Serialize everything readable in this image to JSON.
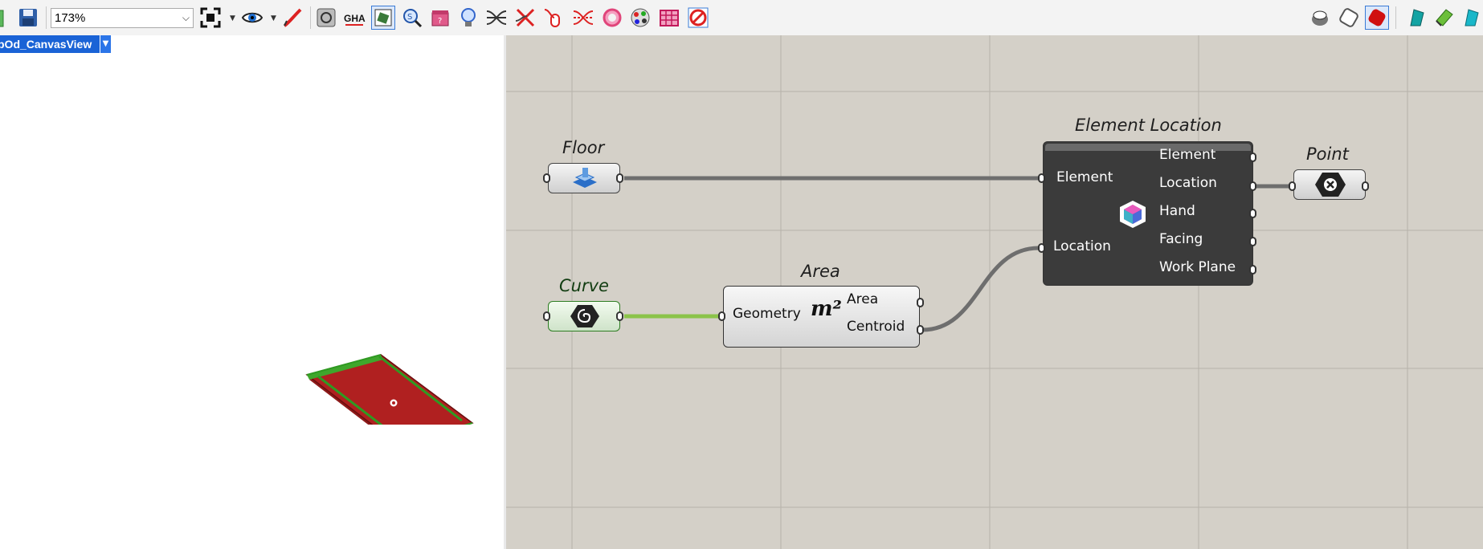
{
  "toolbar": {
    "zoom_value": "173%"
  },
  "viewport": {
    "label": "pOd_CanvasView"
  },
  "canvas": {
    "floor": {
      "caption": "Floor",
      "icon": "floor-element-icon"
    },
    "curve": {
      "caption": "Curve",
      "icon": "curve-param-icon"
    },
    "area": {
      "caption": "Area",
      "input": "Geometry",
      "outputs": [
        "Area",
        "Centroid"
      ],
      "icon": "m-squared-icon"
    },
    "element_location": {
      "caption": "Element Location",
      "inputs": [
        "Element",
        "Location"
      ],
      "outputs": [
        "Element",
        "Location",
        "Hand",
        "Facing",
        "Work Plane"
      ],
      "icon": "location-cube-icon"
    },
    "point": {
      "caption": "Point",
      "icon": "point-param-icon"
    }
  },
  "colors": {
    "canvas_bg": "#d4d0c8",
    "dark_component": "#3b3b3b",
    "curve_wire": "#8bc34a",
    "floor_red": "#b02020"
  }
}
